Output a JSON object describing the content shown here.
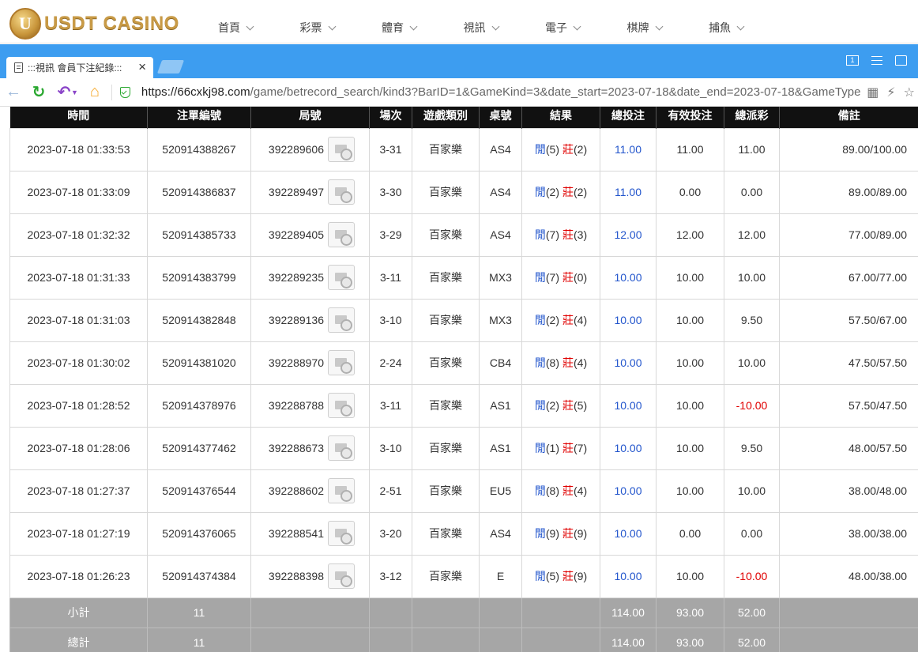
{
  "site": {
    "logo_text": "USDT CASINO",
    "logo_letter": "U",
    "nav": [
      "首頁",
      "彩票",
      "體育",
      "視訊",
      "電子",
      "棋牌",
      "捕魚"
    ]
  },
  "browser": {
    "tab_title": ":::視訊 會員下注紀錄:::",
    "tab_close": "×",
    "window_badge": "1",
    "url_domain": "https://66cxkj98.com",
    "url_path": "/game/betrecord_search/kind3?BarID=1&GameKind=3&date_start=2023-07-18&date_end=2023-07-18&GameType"
  },
  "table": {
    "headers": [
      "時間",
      "注單編號",
      "局號",
      "場次",
      "遊戲類別",
      "桌號",
      "結果",
      "總投注",
      "有效投注",
      "總派彩",
      "備註"
    ],
    "rows": [
      {
        "time": "2023-07-18 01:33:53",
        "order": "520914388267",
        "round": "392289606",
        "session": "3-31",
        "game": "百家樂",
        "table": "AS4",
        "p_label": "閒",
        "p_val": "(5)",
        "b_label": "莊",
        "b_val": "(2)",
        "bet": "11.00",
        "valid": "11.00",
        "payout": "11.00",
        "note": "89.00/100.00"
      },
      {
        "time": "2023-07-18 01:33:09",
        "order": "520914386837",
        "round": "392289497",
        "session": "3-30",
        "game": "百家樂",
        "table": "AS4",
        "p_label": "閒",
        "p_val": "(2)",
        "b_label": "莊",
        "b_val": "(2)",
        "bet": "11.00",
        "valid": "0.00",
        "payout": "0.00",
        "note": "89.00/89.00"
      },
      {
        "time": "2023-07-18 01:32:32",
        "order": "520914385733",
        "round": "392289405",
        "session": "3-29",
        "game": "百家樂",
        "table": "AS4",
        "p_label": "閒",
        "p_val": "(7)",
        "b_label": "莊",
        "b_val": "(3)",
        "bet": "12.00",
        "valid": "12.00",
        "payout": "12.00",
        "note": "77.00/89.00"
      },
      {
        "time": "2023-07-18 01:31:33",
        "order": "520914383799",
        "round": "392289235",
        "session": "3-11",
        "game": "百家樂",
        "table": "MX3",
        "p_label": "閒",
        "p_val": "(7)",
        "b_label": "莊",
        "b_val": "(0)",
        "bet": "10.00",
        "valid": "10.00",
        "payout": "10.00",
        "note": "67.00/77.00"
      },
      {
        "time": "2023-07-18 01:31:03",
        "order": "520914382848",
        "round": "392289136",
        "session": "3-10",
        "game": "百家樂",
        "table": "MX3",
        "p_label": "閒",
        "p_val": "(2)",
        "b_label": "莊",
        "b_val": "(4)",
        "bet": "10.00",
        "valid": "10.00",
        "payout": "9.50",
        "note": "57.50/67.00"
      },
      {
        "time": "2023-07-18 01:30:02",
        "order": "520914381020",
        "round": "392288970",
        "session": "2-24",
        "game": "百家樂",
        "table": "CB4",
        "p_label": "閒",
        "p_val": "(8)",
        "b_label": "莊",
        "b_val": "(4)",
        "bet": "10.00",
        "valid": "10.00",
        "payout": "10.00",
        "note": "47.50/57.50"
      },
      {
        "time": "2023-07-18 01:28:52",
        "order": "520914378976",
        "round": "392288788",
        "session": "3-11",
        "game": "百家樂",
        "table": "AS1",
        "p_label": "閒",
        "p_val": "(2)",
        "b_label": "莊",
        "b_val": "(5)",
        "bet": "10.00",
        "valid": "10.00",
        "payout": "-10.00",
        "note": "57.50/47.50"
      },
      {
        "time": "2023-07-18 01:28:06",
        "order": "520914377462",
        "round": "392288673",
        "session": "3-10",
        "game": "百家樂",
        "table": "AS1",
        "p_label": "閒",
        "p_val": "(1)",
        "b_label": "莊",
        "b_val": "(7)",
        "bet": "10.00",
        "valid": "10.00",
        "payout": "9.50",
        "note": "48.00/57.50"
      },
      {
        "time": "2023-07-18 01:27:37",
        "order": "520914376544",
        "round": "392288602",
        "session": "2-51",
        "game": "百家樂",
        "table": "EU5",
        "p_label": "閒",
        "p_val": "(8)",
        "b_label": "莊",
        "b_val": "(4)",
        "bet": "10.00",
        "valid": "10.00",
        "payout": "10.00",
        "note": "38.00/48.00"
      },
      {
        "time": "2023-07-18 01:27:19",
        "order": "520914376065",
        "round": "392288541",
        "session": "3-20",
        "game": "百家樂",
        "table": "AS4",
        "p_label": "閒",
        "p_val": "(9)",
        "b_label": "莊",
        "b_val": "(9)",
        "bet": "10.00",
        "valid": "0.00",
        "payout": "0.00",
        "note": "38.00/38.00"
      },
      {
        "time": "2023-07-18 01:26:23",
        "order": "520914374384",
        "round": "392288398",
        "session": "3-12",
        "game": "百家樂",
        "table": "E",
        "p_label": "閒",
        "p_val": "(5)",
        "b_label": "莊",
        "b_val": "(9)",
        "bet": "10.00",
        "valid": "10.00",
        "payout": "-10.00",
        "note": "48.00/38.00"
      }
    ],
    "subtotal": {
      "label": "小計",
      "count": "11",
      "bet": "114.00",
      "valid": "93.00",
      "payout": "52.00"
    },
    "total": {
      "label": "總計",
      "count": "11",
      "bet": "114.00",
      "valid": "93.00",
      "payout": "52.00"
    }
  },
  "colors": {
    "player": "#2255cc",
    "banker": "#e00000",
    "browser_blue": "#3d9df0",
    "header_black": "#111111",
    "summary_gray": "#a6a6a6"
  }
}
